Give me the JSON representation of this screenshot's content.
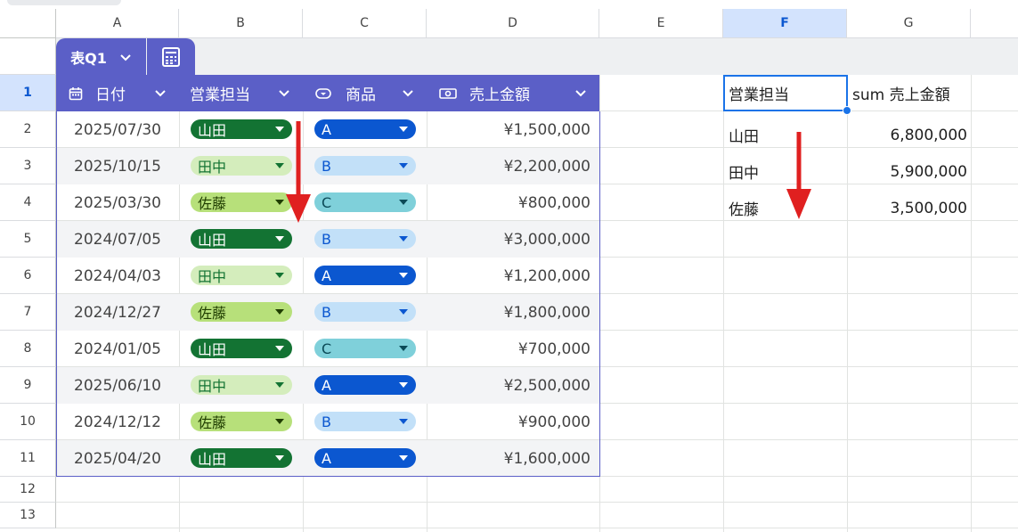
{
  "columns": [
    "A",
    "B",
    "C",
    "D",
    "E",
    "F",
    "G"
  ],
  "rows": [
    "1",
    "2",
    "3",
    "4",
    "5",
    "6",
    "7",
    "8",
    "9",
    "10",
    "11",
    "12",
    "13"
  ],
  "table": {
    "name": "表Q1",
    "headers": [
      "日付",
      "営業担当",
      "商品",
      "売上金額"
    ],
    "rows": [
      {
        "date": "2025/07/30",
        "rep": "山田",
        "product": "A",
        "amount": "¥1,500,000"
      },
      {
        "date": "2025/10/15",
        "rep": "田中",
        "product": "B",
        "amount": "¥2,200,000"
      },
      {
        "date": "2025/03/30",
        "rep": "佐藤",
        "product": "C",
        "amount": "¥800,000"
      },
      {
        "date": "2024/07/05",
        "rep": "山田",
        "product": "B",
        "amount": "¥3,000,000"
      },
      {
        "date": "2024/04/03",
        "rep": "田中",
        "product": "A",
        "amount": "¥1,200,000"
      },
      {
        "date": "2024/12/27",
        "rep": "佐藤",
        "product": "B",
        "amount": "¥1,800,000"
      },
      {
        "date": "2024/01/05",
        "rep": "山田",
        "product": "C",
        "amount": "¥700,000"
      },
      {
        "date": "2025/06/10",
        "rep": "田中",
        "product": "A",
        "amount": "¥2,500,000"
      },
      {
        "date": "2024/12/12",
        "rep": "佐藤",
        "product": "B",
        "amount": "¥900,000"
      },
      {
        "date": "2025/04/20",
        "rep": "山田",
        "product": "A",
        "amount": "¥1,600,000"
      }
    ]
  },
  "summary": {
    "header_rep": "営業担当",
    "header_sum": "sum 売上金額",
    "rows": [
      {
        "rep": "山田",
        "total": "6,800,000"
      },
      {
        "rep": "田中",
        "total": "5,900,000"
      },
      {
        "rep": "佐藤",
        "total": "3,500,000"
      }
    ]
  },
  "chip_colors": {
    "山田": {
      "bg": "#137333",
      "fg": "#ffffff"
    },
    "田中": {
      "bg": "#d4edbc",
      "fg": "#137333"
    },
    "佐藤": {
      "bg": "#b7e07a",
      "fg": "#1f3d00"
    },
    "A": {
      "bg": "#0b57d0",
      "fg": "#ffffff"
    },
    "B": {
      "bg": "#c2e0f8",
      "fg": "#0b57d0"
    },
    "C": {
      "bg": "#7fd0da",
      "fg": "#0b4a57"
    }
  },
  "accent": "#5b5fc7",
  "arrow_color": "#e02020",
  "icons": [
    "chevron-down-icon",
    "calculator-icon",
    "calendar-icon",
    "dropdown-chip-icon",
    "money-icon",
    "arrow-down-icon"
  ]
}
